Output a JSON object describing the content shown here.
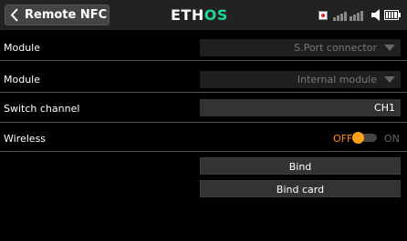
{
  "header": {
    "back_icon": "chevron-left-icon",
    "title": "Remote NFC",
    "logo_part1": "ETH",
    "logo_part2": "OS",
    "accent_color": "#1fd59e",
    "status_icons": [
      "record-icon",
      "signal-bars-icon",
      "speaker-icon",
      "battery-icon"
    ]
  },
  "rows": {
    "module1": {
      "label": "Module",
      "value": "S.Port connector"
    },
    "module2": {
      "label": "Module",
      "value": "Internal module"
    },
    "switch_channel": {
      "label": "Switch channel",
      "value": "CH1"
    },
    "wireless": {
      "label": "Wireless",
      "off_label": "OFF",
      "on_label": "ON",
      "state": "off",
      "toggle_color": "#ffa019"
    }
  },
  "buttons": {
    "bind": "Bind",
    "bind_card": "Bind card"
  }
}
